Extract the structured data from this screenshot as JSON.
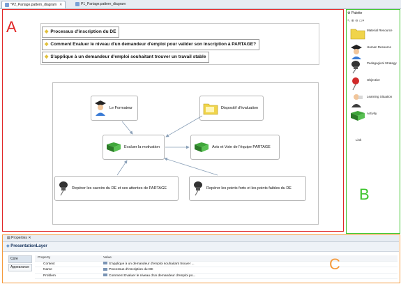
{
  "tabs": [
    {
      "label": "*P2_Partage.pattern_diagram",
      "active": true
    },
    {
      "label": "P1_Partage.pattern_diagram",
      "active": false
    }
  ],
  "regions": {
    "a": "A",
    "b": "B",
    "c": "C"
  },
  "layers": [
    "Processus d'inscription du DE",
    "Comment Evaluer le niveau d'un demandeur d'emploi pour valider son inscription à PARTAGE?",
    "S'applique à un demandeur d'emploi souhaitant trouver un travail stable"
  ],
  "nodes": {
    "formateur": "Le Formateur",
    "dispositif": "Dispositif d'évaluation",
    "evaluer": "Evaluer la motivation",
    "avis": "Avis et Vote de l'équipe PARTAGE",
    "savoirs": "Repérer les savoirs du DE et ses attentes de PARTAGE",
    "points": "Repérer les points forts et les points faibles du DE"
  },
  "palette": {
    "title": "Palette",
    "items": [
      {
        "label": "Material Resource",
        "icon": "folder-icon"
      },
      {
        "label": "Human Resource",
        "icon": "graduate-icon"
      },
      {
        "label": "Pedagogical Strategy",
        "icon": "pushpin-icon"
      },
      {
        "label": "Objective",
        "icon": "pin-icon"
      },
      {
        "label": "Learning Situation",
        "icon": "teacher-icon"
      },
      {
        "label": "Activity",
        "icon": "book-icon"
      }
    ],
    "link": "Link"
  },
  "properties": {
    "tab": "Properties",
    "title": "PresentationLayer",
    "side_tabs": [
      "Core",
      "Appearance"
    ],
    "headers": {
      "property": "Property",
      "value": "Value"
    },
    "rows": [
      {
        "property": "Context",
        "value": "S'applique à un demandeur d'emploi souhaitant trouver ..."
      },
      {
        "property": "Name",
        "value": "Processus d'inscription du DE"
      },
      {
        "property": "Problem",
        "value": "Comment Evaluer le niveau d'un demandeur d'emploi po..."
      }
    ]
  },
  "colors": {
    "region_a": "#e02626",
    "region_b": "#3cc42c",
    "region_c": "#f59a3c"
  }
}
